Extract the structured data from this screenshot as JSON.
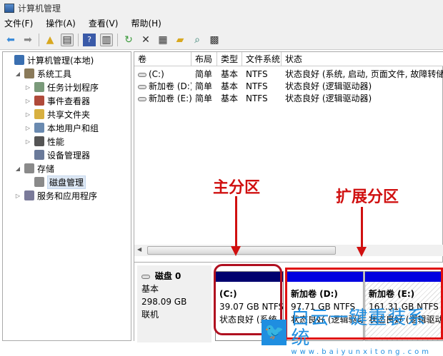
{
  "window": {
    "title": "计算机管理"
  },
  "menu": [
    "文件(F)",
    "操作(A)",
    "查看(V)",
    "帮助(H)"
  ],
  "tree": [
    {
      "label": "计算机管理(本地)",
      "level": 0,
      "twisty": "",
      "color": "#3a6fb0"
    },
    {
      "label": "系统工具",
      "level": 1,
      "twisty": "◢",
      "color": "#8a7a5a"
    },
    {
      "label": "任务计划程序",
      "level": 2,
      "twisty": "▷",
      "color": "#7a9a7a"
    },
    {
      "label": "事件查看器",
      "level": 2,
      "twisty": "▷",
      "color": "#b04a3a"
    },
    {
      "label": "共享文件夹",
      "level": 2,
      "twisty": "▷",
      "color": "#d8b040"
    },
    {
      "label": "本地用户和组",
      "level": 2,
      "twisty": "▷",
      "color": "#6a8ab0"
    },
    {
      "label": "性能",
      "level": 2,
      "twisty": "▷",
      "color": "#555"
    },
    {
      "label": "设备管理器",
      "level": 2,
      "twisty": "",
      "color": "#6a7a9a"
    },
    {
      "label": "存储",
      "level": 1,
      "twisty": "◢",
      "color": "#8a8a8a"
    },
    {
      "label": "磁盘管理",
      "level": 2,
      "twisty": "",
      "color": "#8a8a8a",
      "selected": true
    },
    {
      "label": "服务和应用程序",
      "level": 1,
      "twisty": "▷",
      "color": "#7a7a9a"
    }
  ],
  "table": {
    "headers": [
      "卷",
      "布局",
      "类型",
      "文件系统",
      "状态"
    ],
    "rows": [
      [
        "(C:)",
        "简单",
        "基本",
        "NTFS",
        "状态良好 (系统, 启动, 页面文件, 故障转储, 主"
      ],
      [
        "新加卷 (D:)",
        "简单",
        "基本",
        "NTFS",
        "状态良好 (逻辑驱动器)"
      ],
      [
        "新加卷 (E:)",
        "简单",
        "基本",
        "NTFS",
        "状态良好 (逻辑驱动器)"
      ]
    ]
  },
  "disk": {
    "name": "磁盘 0",
    "type": "基本",
    "size": "298.09 GB",
    "status": "联机"
  },
  "partitions": [
    {
      "name": "(C:)",
      "size": "39.07 GB NTFS",
      "status": "状态良好 (系统, 启",
      "bar": "#00006e"
    },
    {
      "name": "新加卷  (D:)",
      "size": "97.71 GB NTFS",
      "status": "状态良好 (逻辑驱动器)",
      "bar": "#0000e0"
    },
    {
      "name": "新加卷  (E:)",
      "size": "161.31 GB NTFS",
      "status": "状态良好 (逻辑驱动器)",
      "bar": "#0000e0"
    }
  ],
  "annotations": {
    "primary": "主分区",
    "extended": "扩展分区"
  },
  "watermark": {
    "title": "白云一键重装系统",
    "url": "www.baiyunxitong.com"
  }
}
